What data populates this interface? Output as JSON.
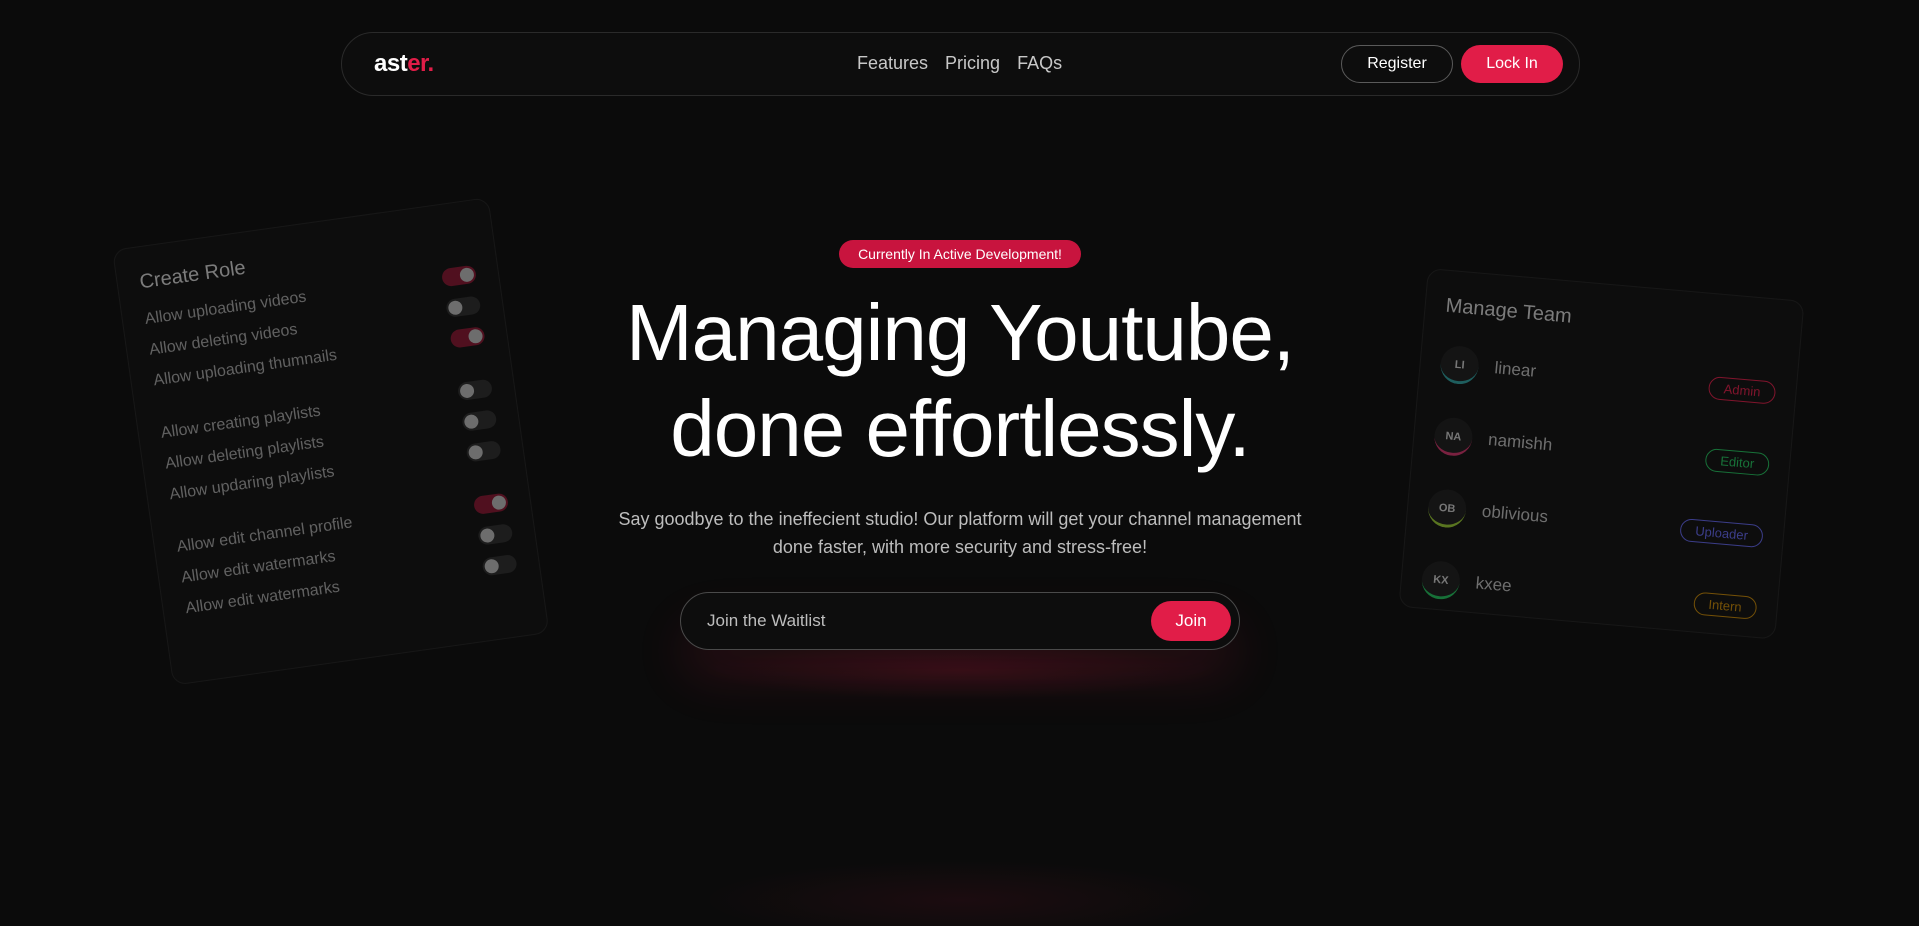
{
  "brand": {
    "logo_main": "ast",
    "logo_accent": "er.",
    "accent_color": "#e11d48"
  },
  "nav": {
    "links": [
      "Features",
      "Pricing",
      "FAQs"
    ],
    "register_label": "Register",
    "login_label": "Lock In"
  },
  "hero": {
    "badge": "Currently In Active Development!",
    "headline_line1": "Managing Youtube,",
    "headline_line2": "done effortlessly.",
    "subtext": "Say goodbye to the ineffecient studio! Our platform will get your channel management done faster, with more security and stress-free!",
    "waitlist_placeholder": "Join the Waitlist",
    "join_label": "Join"
  },
  "create_role": {
    "title": "Create Role",
    "permissions": [
      {
        "label": "Allow uploading videos",
        "on": true
      },
      {
        "label": "Allow deleting videos",
        "on": false
      },
      {
        "label": "Allow uploading thumnails",
        "on": true
      },
      {
        "label": "Allow creating playlists",
        "on": false
      },
      {
        "label": "Allow deleting playlists",
        "on": false
      },
      {
        "label": "Allow updaring playlists",
        "on": false
      },
      {
        "label": "Allow edit channel profile",
        "on": true
      },
      {
        "label": "Allow edit watermarks",
        "on": false
      },
      {
        "label": "Allow edit watermarks",
        "on": false
      }
    ]
  },
  "manage_team": {
    "title": "Manage Team",
    "members": [
      {
        "initials": "LI",
        "name": "linear",
        "role": "Admin",
        "color": "#e11d48",
        "ring": "#2fa3a3"
      },
      {
        "initials": "NA",
        "name": "namishh",
        "role": "Editor",
        "color": "#22c55e",
        "ring": "#d6336c"
      },
      {
        "initials": "OB",
        "name": "oblivious",
        "role": "Uploader",
        "color": "#6366f1",
        "ring": "#9acd32"
      },
      {
        "initials": "KX",
        "name": "kxee",
        "role": "Intern",
        "color": "#ca8a04",
        "ring": "#22c55e"
      }
    ]
  }
}
